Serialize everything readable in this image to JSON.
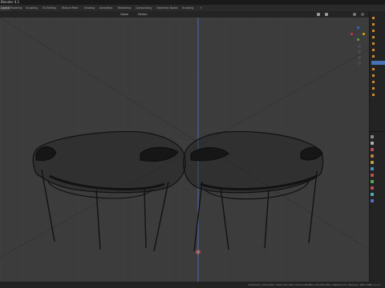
{
  "app": {
    "title": "Blender 4.1"
  },
  "tabs": [
    {
      "label": "Layout"
    },
    {
      "label": "Modeling"
    },
    {
      "label": "Sculpting"
    },
    {
      "label": "UV Editing"
    },
    {
      "label": "Texture Paint"
    },
    {
      "label": "Shading"
    },
    {
      "label": "Animation"
    },
    {
      "label": "Rendering"
    },
    {
      "label": "Compositing"
    },
    {
      "label": "Geometry Nodes"
    },
    {
      "label": "Scripting"
    },
    {
      "label": "+"
    }
  ],
  "header": {
    "transform_orientation": "Global",
    "pivot": "Median"
  },
  "status": {
    "text": "Collection | Chair.001 | Verts:147,264 | Faces:146,880 | Tris:293,760 | Objects:1/2 | Memory: 265.2 MiB | 4.1.1"
  },
  "colors": {
    "accent": "#4772b3",
    "viewport": "#3c3c3c",
    "grid": "#454545",
    "mesh": "#141414",
    "axis_y": "#4f7ad1"
  },
  "icons": [
    "view-icon",
    "select-icon",
    "gizmo-x",
    "gizmo-y",
    "gizmo-z",
    "zoom-icon",
    "pan-icon",
    "camera-icon",
    "grid-icon",
    "3d-cursor-icon"
  ]
}
